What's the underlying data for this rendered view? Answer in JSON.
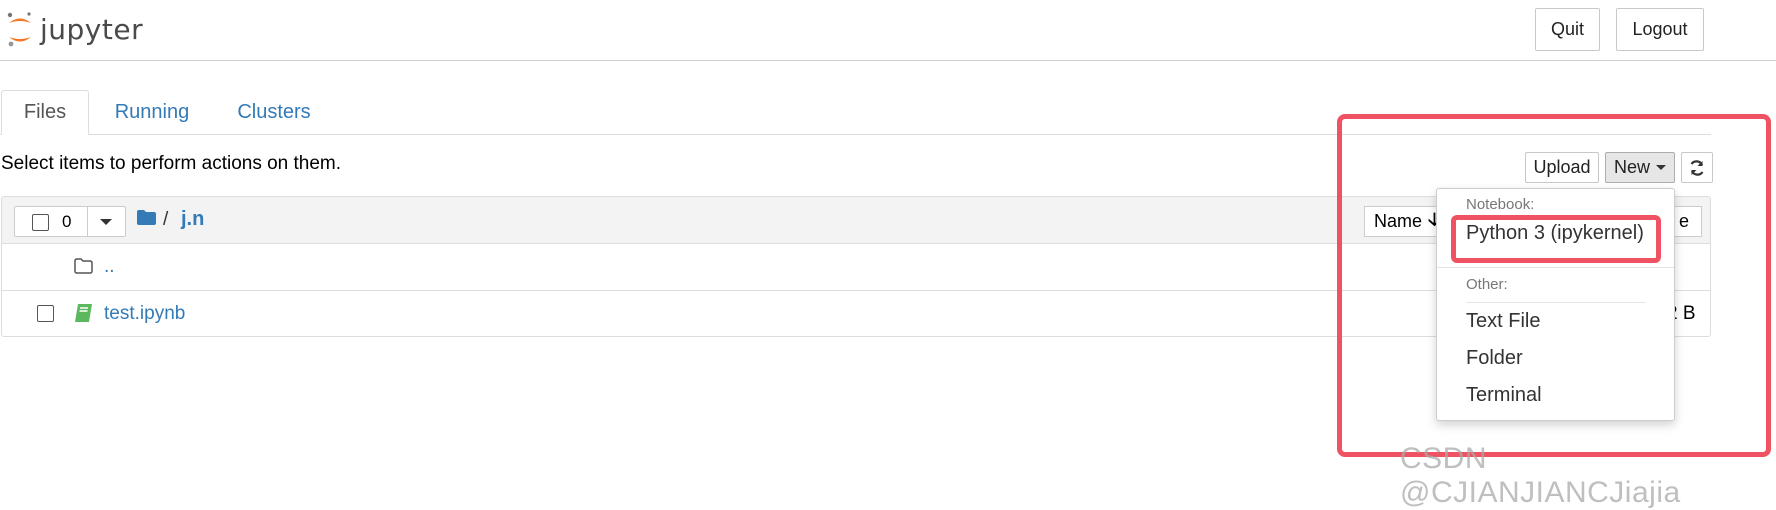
{
  "header": {
    "logo_text": "jupyter",
    "quit_label": "Quit",
    "logout_label": "Logout"
  },
  "tabs": [
    {
      "label": "Files"
    },
    {
      "label": "Running"
    },
    {
      "label": "Clusters"
    }
  ],
  "toolbar": {
    "instructions": "Select items to perform actions on them.",
    "upload_label": "Upload",
    "new_label": "New",
    "refresh_icon": "refresh-icon"
  },
  "file_list": {
    "selected_count": "0",
    "breadcrumb_sep": "/",
    "breadcrumb_dir": "j.n",
    "name_sort_label": "Name",
    "partially_hidden_header": "e",
    "rows": [
      {
        "name": "..",
        "size": ""
      },
      {
        "name": "test.ipynb",
        "size": "2 B"
      }
    ]
  },
  "new_menu": {
    "notebook_header": "Notebook:",
    "notebook_items": [
      "Python 3 (ipykernel)"
    ],
    "other_header": "Other:",
    "other_items": [
      "Text File",
      "Folder",
      "Terminal"
    ]
  },
  "colors": {
    "link": "#337ab7",
    "highlight": "#ef5363",
    "logo_orange": "#f37726",
    "notebook_green": "#5cb85c"
  },
  "watermark": "CSDN @CJIANJIANCJiajia"
}
